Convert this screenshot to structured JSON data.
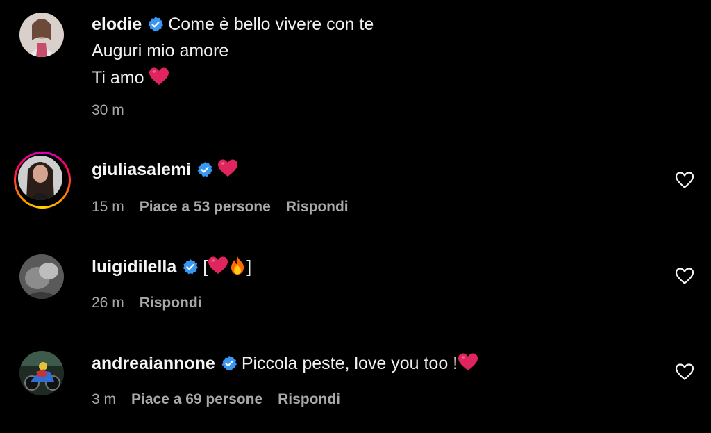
{
  "comments": [
    {
      "username": "elodie",
      "text_lines": [
        "Come è bello vivere con te",
        "Auguri mio amore",
        "Ti amo"
      ],
      "time": "30 m"
    },
    {
      "username": "giuliasalemi",
      "text": "",
      "time": "15 m",
      "likes": "Piace a 53 persone",
      "reply": "Rispondi"
    },
    {
      "username": "luigidilella",
      "text_open": "[",
      "text_close": "]",
      "time": "26 m",
      "reply": "Rispondi"
    },
    {
      "username": "andreaiannone",
      "text": "Piccola peste, love you too !",
      "time": "3 m",
      "likes": "Piace a 69 persone",
      "reply": "Rispondi"
    }
  ],
  "icons": {
    "verified": "verified-badge-icon",
    "heart": "heart-outline-icon",
    "heart_emoji": "red-heart-emoji",
    "fire_emoji": "fire-emoji"
  },
  "colors": {
    "background": "#000000",
    "text": "#f5f5f5",
    "secondary": "#a8a8a8",
    "verified": "#3897f0",
    "heart_red": "#e0245e"
  }
}
